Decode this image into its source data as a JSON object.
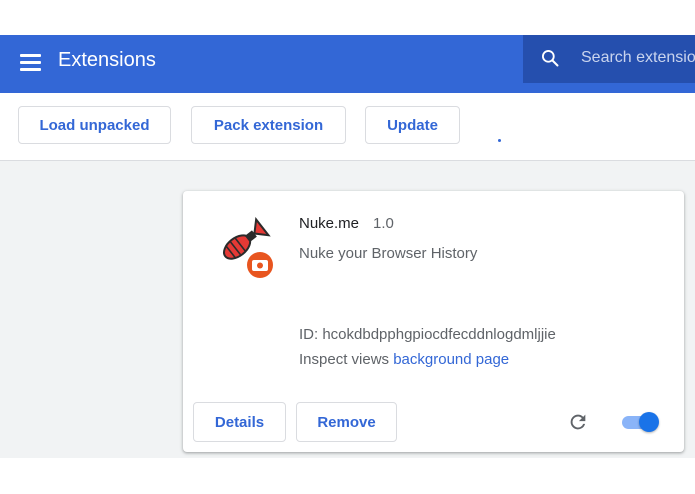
{
  "header": {
    "title": "Extensions",
    "search_placeholder": "Search extensions"
  },
  "toolbar": {
    "load_unpacked": "Load unpacked",
    "pack_extension": "Pack extension",
    "update": "Update"
  },
  "extension": {
    "name": "Nuke.me",
    "version": "1.0",
    "description": "Nuke your Browser History",
    "id_text": "ID: hcokdbdpphgpiocdfecddnlogdmljjie",
    "inspect_prefix": "Inspect views",
    "inspect_link": "background page",
    "details_label": "Details",
    "remove_label": "Remove",
    "enabled": true
  },
  "colors": {
    "header_bg": "#3367d6",
    "accent": "#3367d6",
    "toggle_on": "#1a73e8",
    "page_bg": "#f1f3f4"
  },
  "icons": {
    "menu": "hamburger-menu-icon",
    "search": "search-icon",
    "extension": "nuke-bomb-icon",
    "badge": "camera-badge-icon",
    "reload": "reload-icon"
  }
}
